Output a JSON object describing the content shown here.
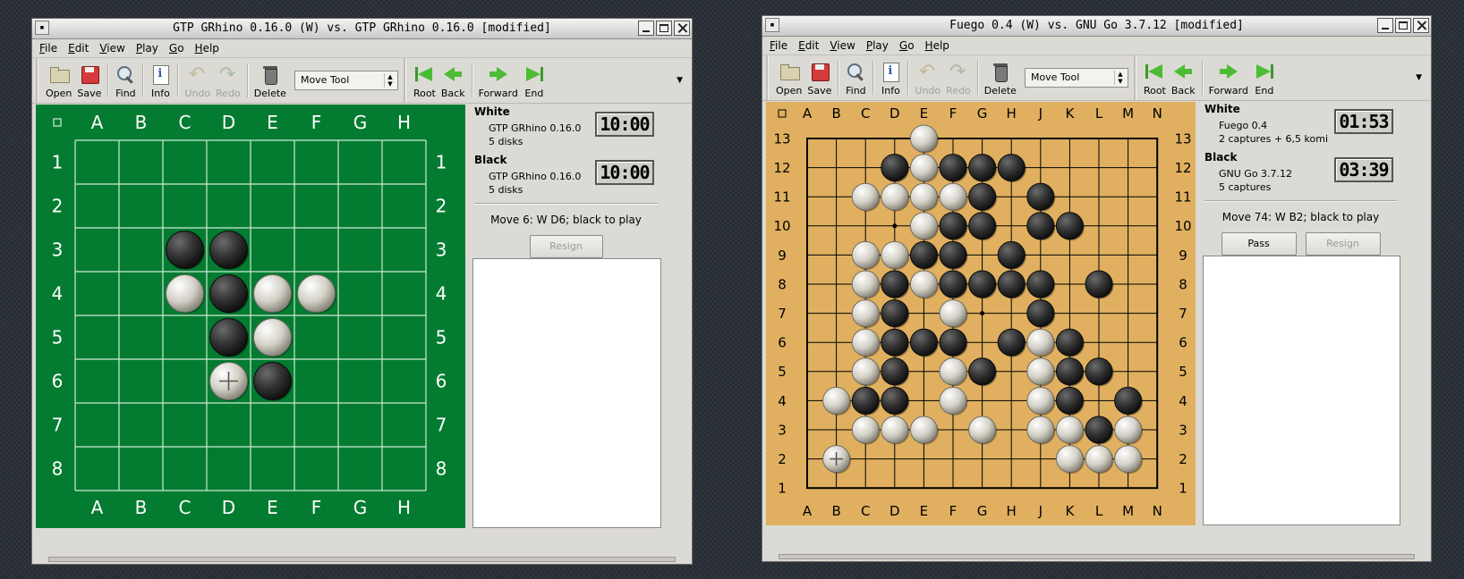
{
  "windows": [
    {
      "title": "GTP GRhino 0.16.0 (W) vs. GTP GRhino 0.16.0 [modified]",
      "menu": [
        "File",
        "Edit",
        "View",
        "Play",
        "Go",
        "Help"
      ],
      "toolbar": {
        "open": "Open",
        "save": "Save",
        "find": "Find",
        "info": "Info",
        "undo": "Undo",
        "redo": "Redo",
        "delete": "Delete",
        "tool": "Move Tool",
        "root": "Root",
        "back": "Back",
        "forward": "Forward",
        "end": "End"
      },
      "board": {
        "type": "othello",
        "size": 8,
        "columns": [
          "A",
          "B",
          "C",
          "D",
          "E",
          "F",
          "G",
          "H"
        ],
        "rows": [
          "1",
          "2",
          "3",
          "4",
          "5",
          "6",
          "7",
          "8"
        ],
        "black": [
          "C3",
          "D3",
          "D4",
          "D5",
          "E6"
        ],
        "white": [
          "C4",
          "E4",
          "F4",
          "E5",
          "D6"
        ],
        "last_move": "D6",
        "colors": {
          "background": "#037c31",
          "lines": "#cfe8d6",
          "labels": "#ffffff"
        }
      },
      "white": {
        "label": "White",
        "name": "GTP GRhino 0.16.0",
        "stat": "5 disks",
        "clock": "10:00"
      },
      "black": {
        "label": "Black",
        "name": "GTP GRhino 0.16.0",
        "stat": "5 disks",
        "clock": "10:00"
      },
      "status": "Move 6: W D6; black to play",
      "buttons": {
        "resign": "Resign"
      }
    },
    {
      "title": "Fuego 0.4 (W) vs. GNU Go 3.7.12 [modified]",
      "menu": [
        "File",
        "Edit",
        "View",
        "Play",
        "Go",
        "Help"
      ],
      "toolbar": {
        "open": "Open",
        "save": "Save",
        "find": "Find",
        "info": "Info",
        "undo": "Undo",
        "redo": "Redo",
        "delete": "Delete",
        "tool": "Move Tool",
        "root": "Root",
        "back": "Back",
        "forward": "Forward",
        "end": "End"
      },
      "board": {
        "type": "go",
        "size": 13,
        "columns": [
          "A",
          "B",
          "C",
          "D",
          "E",
          "F",
          "G",
          "H",
          "J",
          "K",
          "L",
          "M",
          "N"
        ],
        "rows": [
          "13",
          "12",
          "11",
          "10",
          "9",
          "8",
          "7",
          "6",
          "5",
          "4",
          "3",
          "2",
          "1"
        ],
        "black": [
          "D12",
          "F12",
          "G12",
          "H12",
          "G11",
          "J11",
          "F10",
          "G10",
          "J10",
          "K10",
          "E9",
          "F9",
          "H9",
          "D8",
          "F8",
          "G8",
          "H8",
          "J8",
          "L8",
          "D7",
          "J7",
          "D6",
          "E6",
          "F6",
          "H6",
          "K6",
          "D5",
          "G5",
          "K5",
          "L5",
          "C4",
          "D4",
          "K4",
          "M4",
          "L3"
        ],
        "white": [
          "E13",
          "E12",
          "C11",
          "D11",
          "E11",
          "F11",
          "E10",
          "C9",
          "D9",
          "C8",
          "E8",
          "C7",
          "F7",
          "C6",
          "J6",
          "C5",
          "F5",
          "J5",
          "B4",
          "F4",
          "J4",
          "C3",
          "D3",
          "E3",
          "G3",
          "J3",
          "K3",
          "M3",
          "K2",
          "L2",
          "M2",
          "B2"
        ],
        "last_move": "B2",
        "hoshi": [
          "D10",
          "K10",
          "G7",
          "D4",
          "K4"
        ],
        "colors": {
          "background": "#e0b060",
          "lines": "#000000",
          "labels": "#000000"
        }
      },
      "white": {
        "label": "White",
        "name": "Fuego 0.4",
        "stat": "2 captures + 6,5 komi",
        "clock": "01:53"
      },
      "black": {
        "label": "Black",
        "name": "GNU Go 3.7.12",
        "stat": "5 captures",
        "clock": "03:39"
      },
      "status": "Move 74: W B2; black to play",
      "buttons": {
        "pass": "Pass",
        "resign": "Resign"
      }
    }
  ]
}
